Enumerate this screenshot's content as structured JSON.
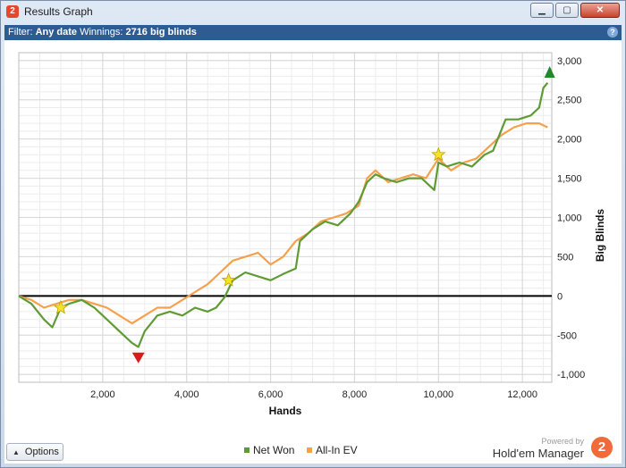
{
  "window": {
    "title": "Results Graph",
    "app_icon_text": "2",
    "buttons": {
      "minimize": "▁",
      "maximize": "▢",
      "close": "✕"
    }
  },
  "filter": {
    "label": "Filter:",
    "value": "Any date",
    "winnings_label": "Winnings:",
    "winnings_value": "2716 big blinds",
    "help": "?"
  },
  "chart_data": {
    "type": "line",
    "xlabel": "Hands",
    "ylabel": "Big Blinds",
    "xlim": [
      0,
      12700
    ],
    "ylim": [
      -1100,
      3100
    ],
    "x_ticks": [
      2000,
      4000,
      6000,
      8000,
      10000,
      12000
    ],
    "x_tick_labels": [
      "2,000",
      "4,000",
      "6,000",
      "8,000",
      "10,000",
      "12,000"
    ],
    "y_ticks": [
      3000,
      2500,
      2000,
      1500,
      1000,
      500,
      0,
      -500,
      -1000
    ],
    "y_tick_labels": [
      "3,000",
      "2,500",
      "2,000",
      "1,500",
      "1,000",
      "500",
      "0",
      "-500",
      "-1,000"
    ],
    "grid": true,
    "legend": "bottom-center",
    "series": [
      {
        "name": "Net Won",
        "color": "#5f9a34",
        "x": [
          0,
          300,
          600,
          800,
          1000,
          1200,
          1500,
          1800,
          2100,
          2400,
          2700,
          2850,
          3000,
          3300,
          3600,
          3900,
          4200,
          4500,
          4700,
          4900,
          5100,
          5400,
          5700,
          6000,
          6300,
          6600,
          6700,
          7000,
          7300,
          7600,
          7900,
          8100,
          8300,
          8500,
          8700,
          9000,
          9300,
          9600,
          9900,
          10000,
          10200,
          10500,
          10800,
          11100,
          11300,
          11600,
          11900,
          12200,
          12400,
          12500,
          12600
        ],
        "y": [
          0,
          -100,
          -300,
          -400,
          -150,
          -100,
          -50,
          -150,
          -300,
          -450,
          -600,
          -650,
          -450,
          -250,
          -200,
          -250,
          -150,
          -200,
          -150,
          -20,
          200,
          300,
          250,
          200,
          280,
          350,
          700,
          850,
          950,
          900,
          1050,
          1200,
          1450,
          1550,
          1500,
          1450,
          1500,
          1500,
          1350,
          1700,
          1650,
          1700,
          1650,
          1800,
          1850,
          2250,
          2250,
          2300,
          2400,
          2650,
          2716
        ]
      },
      {
        "name": "All-In EV",
        "color": "#f5a04a",
        "x": [
          0,
          300,
          600,
          900,
          1200,
          1500,
          1800,
          2100,
          2400,
          2700,
          3000,
          3300,
          3600,
          3900,
          4200,
          4500,
          4800,
          5100,
          5400,
          5700,
          6000,
          6300,
          6600,
          6900,
          7200,
          7500,
          7800,
          8100,
          8300,
          8500,
          8800,
          9100,
          9400,
          9700,
          10000,
          10300,
          10600,
          10900,
          11200,
          11500,
          11800,
          12100,
          12400,
          12600
        ],
        "y": [
          0,
          -50,
          -150,
          -100,
          -50,
          -50,
          -100,
          -150,
          -250,
          -350,
          -250,
          -150,
          -150,
          -50,
          50,
          150,
          300,
          450,
          500,
          550,
          400,
          500,
          700,
          800,
          950,
          1000,
          1050,
          1150,
          1500,
          1600,
          1450,
          1500,
          1550,
          1500,
          1750,
          1600,
          1700,
          1750,
          1900,
          2050,
          2150,
          2200,
          2200,
          2150
        ]
      }
    ],
    "markers": [
      {
        "shape": "star",
        "color": "#f6e227",
        "x": 1000,
        "y": -150
      },
      {
        "shape": "star",
        "color": "#f6e227",
        "x": 5000,
        "y": 200
      },
      {
        "shape": "star",
        "color": "#f6e227",
        "x": 10000,
        "y": 1800
      },
      {
        "shape": "triangle-down",
        "color": "#d61c1c",
        "x": 2850,
        "y": -790
      },
      {
        "shape": "triangle-up",
        "color": "#1f8a2b",
        "x": 12650,
        "y": 2850
      }
    ]
  },
  "footer": {
    "options_label": "Options",
    "powered_by": "Powered by",
    "brand": "Hold'em Manager",
    "brand_logo": "2"
  }
}
